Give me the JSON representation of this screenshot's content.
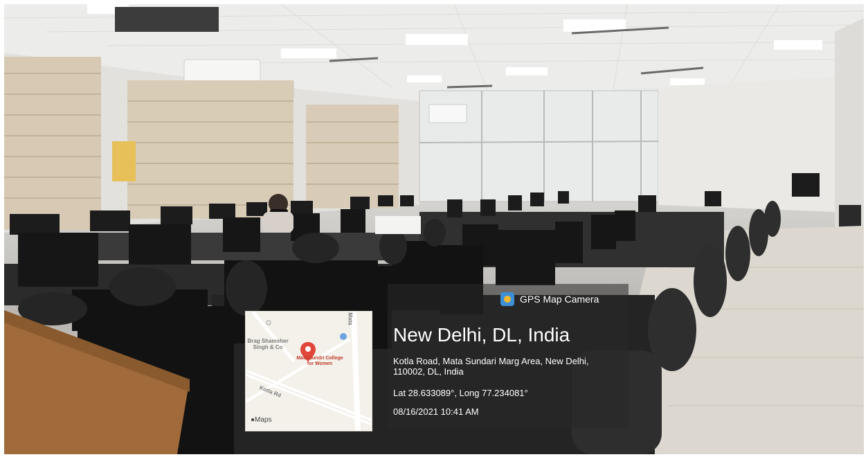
{
  "photo": {
    "description_hidden": "",
    "colors": {
      "ceiling": "#ededeb",
      "floor": "#d8d4cb",
      "monitor": "#1b1b1b",
      "desk": "#a06a3a"
    }
  },
  "stamp": {
    "brand": "GPS Map Camera",
    "brand_icon": "gps-map-camera-icon",
    "location_title": "New Delhi, DL, India",
    "address": "Kotla Road, Mata Sundari Marg Area, New Delhi, 110002, DL, India",
    "latlong": "Lat 28.633089°, Long 77.234081°",
    "datetime": "08/16/2021 10:41 AM"
  },
  "map": {
    "poi_label": "Mata Sundri College for Women",
    "nearby_label": "Brag Shamsher Singh & Co",
    "road_label": "Kotla Rd",
    "side_road_label": "Mata",
    "logo": "Maps",
    "pin_color": "#e0463a"
  }
}
